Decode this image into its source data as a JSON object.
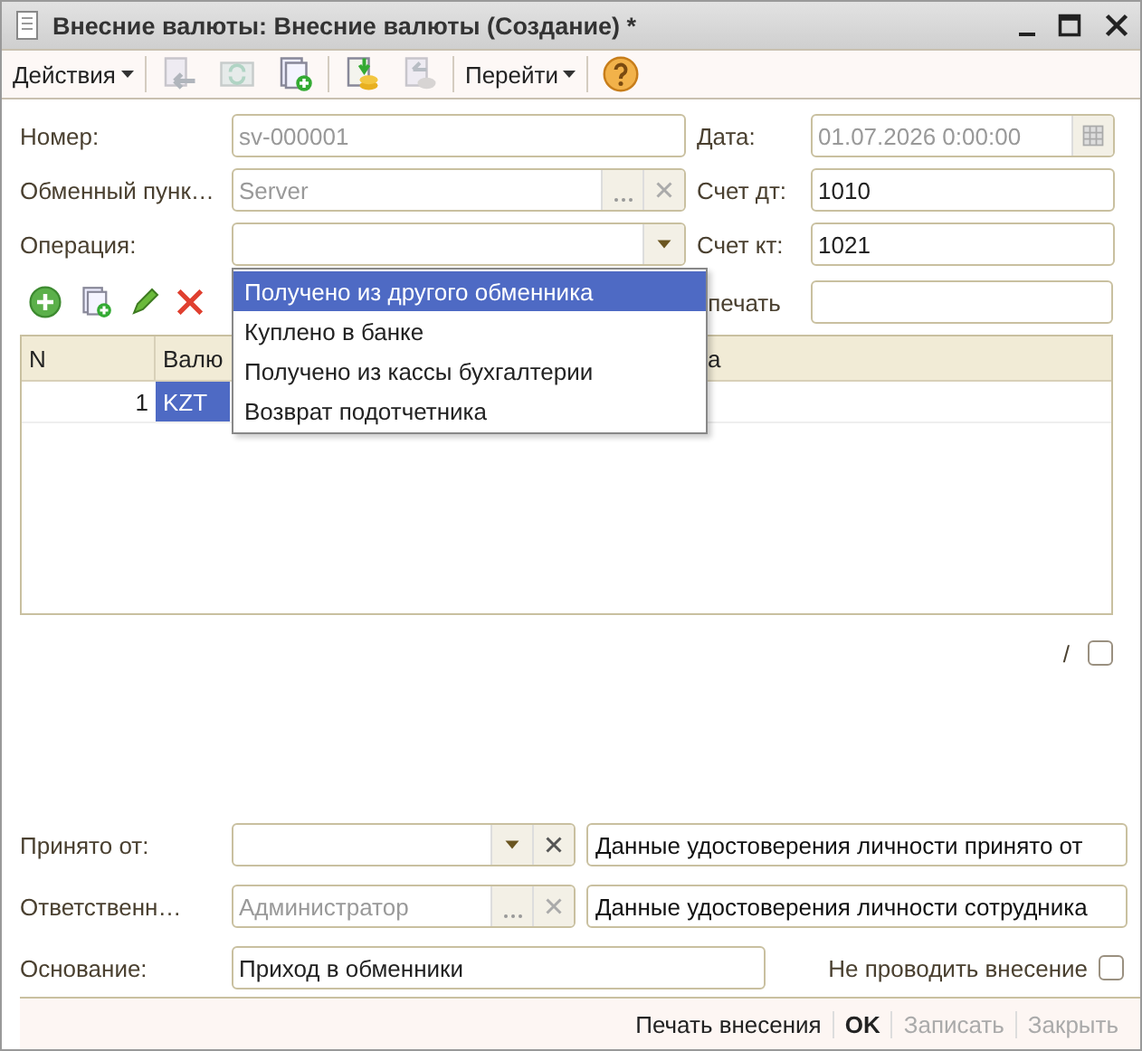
{
  "window": {
    "title": "Внесние валюты: Внесние валюты (Создание) *"
  },
  "toolbar": [
    {
      "kind": "menu",
      "label": "Действия"
    },
    {
      "kind": "separator"
    },
    {
      "kind": "icon",
      "disabled": true
    },
    {
      "kind": "icon",
      "disabled": true
    },
    {
      "kind": "icon",
      "disabled": false
    },
    {
      "kind": "separator"
    },
    {
      "kind": "icon",
      "disabled": false
    },
    {
      "kind": "icon",
      "disabled": true
    },
    {
      "kind": "separator"
    },
    {
      "kind": "menu",
      "label": "Перейти"
    },
    {
      "kind": "separator"
    },
    {
      "kind": "icon",
      "disabled": false
    }
  ],
  "header": {
    "number": {
      "label": "Номер:",
      "value": "sv-000001",
      "disabled": true
    },
    "date": {
      "label": "Дата:",
      "value": "01.07.2026  0:00:00",
      "disabled": true
    },
    "exchange_point": {
      "label": "Обменный пунк…",
      "value": "Server",
      "disabled": true
    },
    "debit_account": {
      "label": "Счет дт:",
      "value": "1010"
    },
    "operation": {
      "label": "Операция:",
      "open": true
    },
    "credit_account": {
      "label": "Счет кт:",
      "value": "1021"
    },
    "print": {
      "label": "печать"
    }
  },
  "dropdown": [
    {
      "label": "Получено из другого обменника",
      "selected": true
    },
    {
      "label": "Куплено в банке",
      "selected": false
    },
    {
      "label": "Получено из кассы бухгалтерии",
      "selected": false
    },
    {
      "label": "Возврат подотчетника",
      "selected": false
    }
  ],
  "table": {
    "columns": [
      "N",
      "Валю",
      "а"
    ],
    "rows": [
      {
        "n": "1",
        "currency": "KZT",
        "selected": true
      }
    ]
  },
  "flag": {
    "label": "/",
    "checked": false
  },
  "accepted_from": {
    "label": "Принято от:",
    "id_button": "Данные удостоверения личности принято от"
  },
  "responsible": {
    "label": "Ответственн…",
    "value": "Администратор",
    "disabled": true,
    "id_button": "Данные удостоверения личности сотрудника"
  },
  "basis": {
    "label": "Основание:",
    "value": "Приход в обменники"
  },
  "no_post": {
    "label": "Не проводить внесение",
    "checked": false
  },
  "footer": [
    {
      "label": "Печать внесения",
      "kind": "link",
      "disabled": false
    },
    {
      "label": "OK",
      "kind": "default",
      "disabled": false
    },
    {
      "label": "Записать",
      "kind": "button",
      "disabled": true
    },
    {
      "label": "Закрыть",
      "kind": "button",
      "disabled": true
    }
  ]
}
